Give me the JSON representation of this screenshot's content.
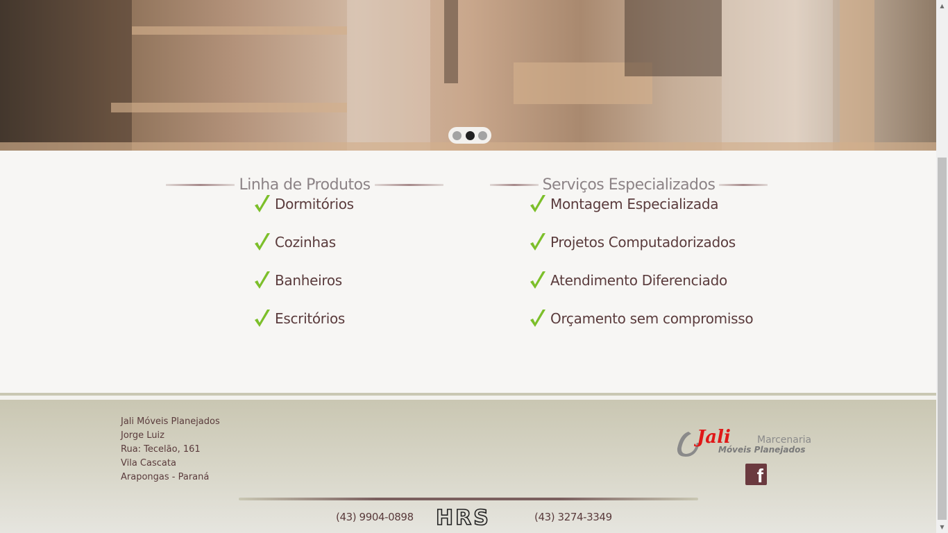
{
  "slider": {
    "dots": [
      {
        "label": "slide-1",
        "active": false
      },
      {
        "label": "slide-2",
        "active": true
      },
      {
        "label": "slide-3",
        "active": false
      }
    ]
  },
  "products": {
    "title": "Linha de Produtos",
    "items": [
      "Dormitórios",
      "Cozinhas",
      "Banheiros",
      "Escritórios"
    ]
  },
  "services": {
    "title": "Serviços Especializados",
    "items": [
      "Montagem Especializada",
      "Projetos Computadorizados",
      "Atendimento Diferenciado",
      "Orçamento sem compromisso"
    ]
  },
  "footer": {
    "address": [
      "Jali Móveis Planejados",
      "Jorge Luiz",
      "Rua: Tecelão, 161",
      "Vila Cascata",
      "Arapongas - Paraná"
    ],
    "logo": {
      "brand": "Jali",
      "line1": "Marcenaria",
      "line2": "Móveis Planejados"
    },
    "phone_1": "(43) 9904-0898",
    "phone_2": "(43) 3274-3349",
    "credit": "HRS",
    "social_icon": "facebook-icon"
  },
  "colors": {
    "check": "#7cbf2a",
    "text": "#5a3b3c",
    "heading": "#8c8386",
    "logo_red": "#e01818"
  }
}
